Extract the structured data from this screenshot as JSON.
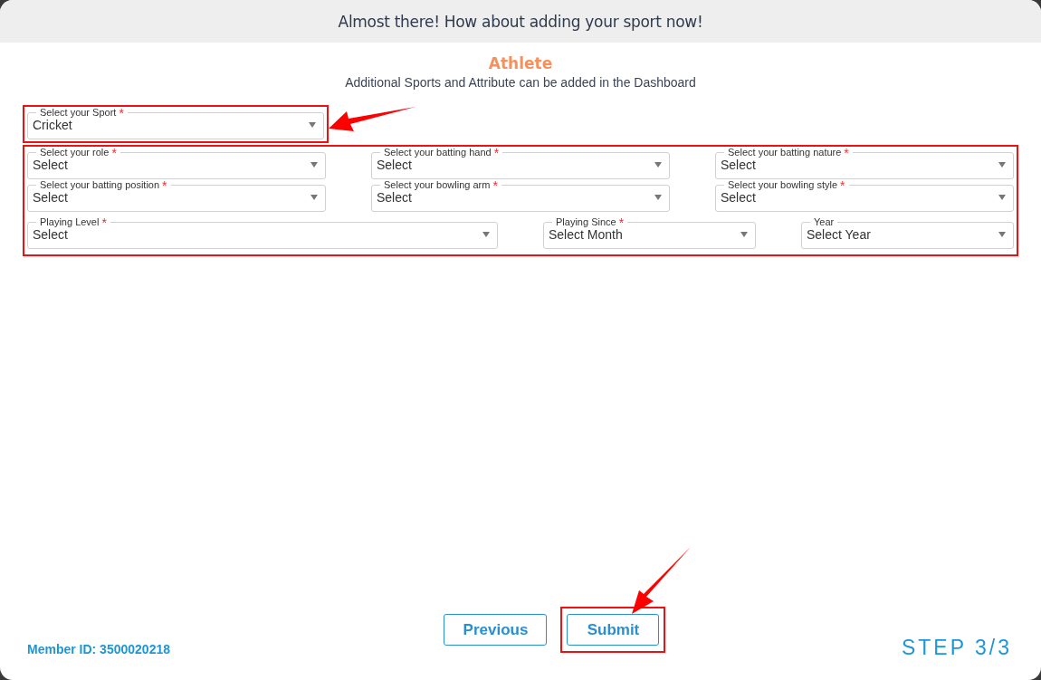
{
  "header": {
    "title": "Almost there! How about adding your sport now!"
  },
  "section": {
    "title": "Athlete",
    "subtitle": "Additional Sports and Attribute can be added in the Dashboard"
  },
  "sport_field": {
    "label": "Select your Sport",
    "required_mark": "*",
    "value": "Cricket"
  },
  "attribute_rows": [
    [
      {
        "label": "Select your role",
        "required_mark": "*",
        "value": "Select",
        "kind": "standard"
      },
      {
        "label": "Select your batting hand",
        "required_mark": "*",
        "value": "Select",
        "kind": "standard"
      },
      {
        "label": "Select your batting nature",
        "required_mark": "*",
        "value": "Select",
        "kind": "standard"
      }
    ],
    [
      {
        "label": "Select your batting position",
        "required_mark": "*",
        "value": "Select",
        "kind": "standard"
      },
      {
        "label": "Select your bowling arm",
        "required_mark": "*",
        "value": "Select",
        "kind": "standard"
      },
      {
        "label": "Select your bowling style",
        "required_mark": "*",
        "value": "Select",
        "kind": "standard"
      }
    ],
    [
      {
        "label": "Playing Level",
        "required_mark": "*",
        "value": "Select",
        "kind": "wide"
      },
      {
        "label": "Playing Since",
        "required_mark": "*",
        "value": "Select Month",
        "kind": "compact"
      },
      {
        "label": "Year",
        "value": "Select Year",
        "kind": "compact"
      }
    ]
  ],
  "footer": {
    "member_id": "Member ID: 3500020218",
    "buttons": [
      {
        "label": "Previous",
        "highlighted": false
      },
      {
        "label": "Submit",
        "highlighted": true
      }
    ],
    "step": "STEP 3/3"
  }
}
